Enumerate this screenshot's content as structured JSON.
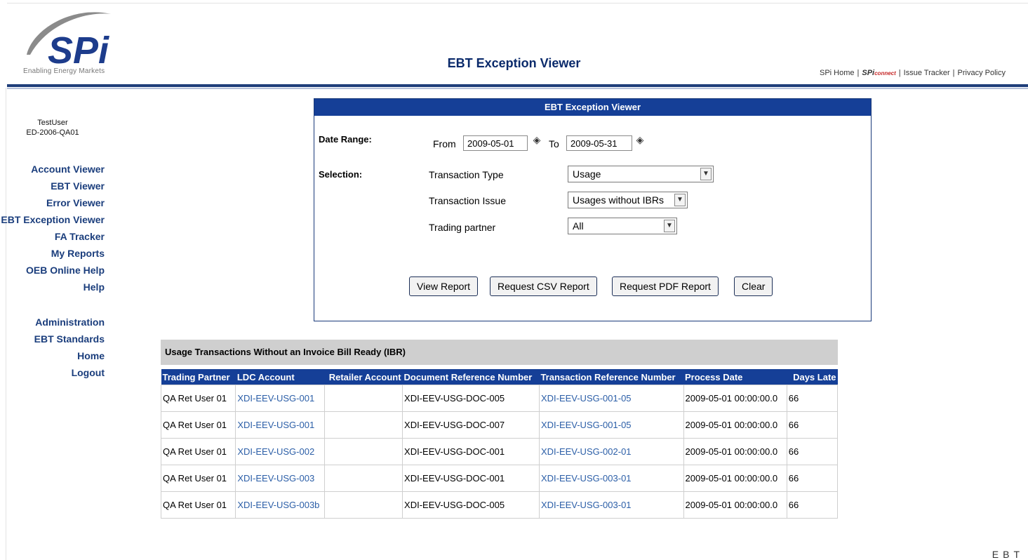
{
  "header": {
    "logo_text": "SPi",
    "logo_tagline": "Enabling Energy Markets",
    "app_title": "EBT Exception Viewer",
    "links": {
      "spi_home": "SPi Home",
      "connect_logo": "SPi",
      "connect_sub": "connect",
      "issue_tracker": "Issue Tracker",
      "privacy_policy": "Privacy Policy",
      "separator": "|"
    }
  },
  "user": {
    "name": "TestUser",
    "id": "ED-2006-QA01"
  },
  "nav": {
    "group1": [
      "Account Viewer",
      "EBT Viewer",
      "Error Viewer",
      "EBT Exception Viewer",
      "FA Tracker",
      "My Reports",
      "OEB Online Help",
      "Help"
    ],
    "group2": [
      "Administration",
      "EBT Standards",
      "Home",
      "Logout"
    ]
  },
  "form": {
    "title": "EBT Exception Viewer",
    "date_range_label": "Date Range:",
    "from_label": "From",
    "from_value": "2009-05-01",
    "to_label": "To",
    "to_value": "2009-05-31",
    "selection_label": "Selection:",
    "transaction_type_label": "Transaction Type",
    "transaction_type_value": "Usage",
    "transaction_issue_label": "Transaction Issue",
    "transaction_issue_value": "Usages without IBRs",
    "trading_partner_label": "Trading partner",
    "trading_partner_value": "All",
    "buttons": {
      "view_report": "View Report",
      "request_csv": "Request CSV Report",
      "request_pdf": "Request PDF Report",
      "clear": "Clear"
    }
  },
  "results": {
    "title": "Usage Transactions Without an Invoice Bill Ready (IBR)",
    "columns": [
      "Trading Partner",
      "LDC Account",
      "Retailer Account",
      "Document Reference Number",
      "Transaction Reference Number",
      "Process Date",
      "Days Late"
    ],
    "rows": [
      [
        "QA Ret User 01",
        "XDI-EEV-USG-001",
        "",
        "XDI-EEV-USG-DOC-005",
        "XDI-EEV-USG-001-05",
        "2009-05-01 00:00:00.0",
        "66"
      ],
      [
        "QA Ret User 01",
        "XDI-EEV-USG-001",
        "",
        "XDI-EEV-USG-DOC-007",
        "XDI-EEV-USG-001-05",
        "2009-05-01 00:00:00.0",
        "66"
      ],
      [
        "QA Ret User 01",
        "XDI-EEV-USG-002",
        "",
        "XDI-EEV-USG-DOC-001",
        "XDI-EEV-USG-002-01",
        "2009-05-01 00:00:00.0",
        "66"
      ],
      [
        "QA Ret User 01",
        "XDI-EEV-USG-003",
        "",
        "XDI-EEV-USG-DOC-001",
        "XDI-EEV-USG-003-01",
        "2009-05-01 00:00:00.0",
        "66"
      ],
      [
        "QA Ret User 01",
        "XDI-EEV-USG-003b",
        "",
        "XDI-EEV-USG-DOC-005",
        "XDI-EEV-USG-003-01",
        "2009-05-01 00:00:00.0",
        "66"
      ]
    ]
  },
  "footer_fragment": "EBT",
  "icons": {
    "calendar": "calendar-icon",
    "dropdown": "chevron-down-icon"
  },
  "colors": {
    "brand": "#153f97",
    "link": "#2b5ea7",
    "nav": "#1a3d7c"
  }
}
